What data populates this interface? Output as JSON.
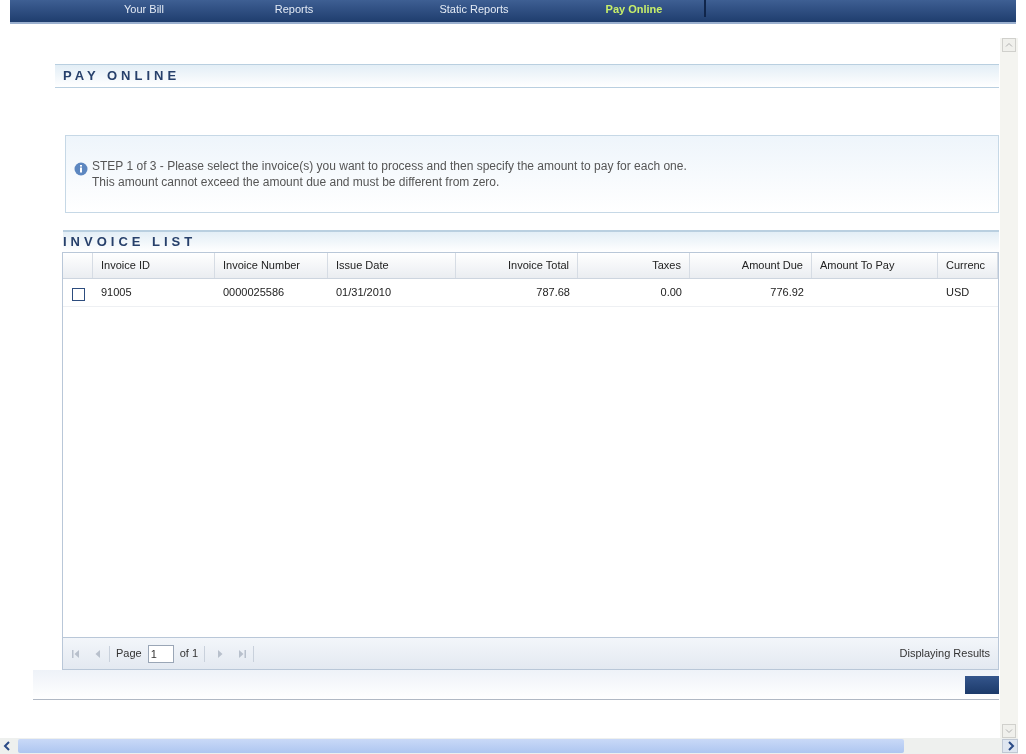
{
  "nav": {
    "tabs": [
      {
        "label": "Your Bill",
        "selected": false
      },
      {
        "label": "Reports",
        "selected": false
      },
      {
        "label": "Static Reports",
        "selected": false
      },
      {
        "label": "Pay Online",
        "selected": true
      }
    ]
  },
  "page_title": "PAY ONLINE",
  "info": {
    "lines": [
      "STEP 1 of 3 - Please select the invoice(s) you want to process and then specify the amount to pay for each one.",
      "This amount cannot exceed the amount due and must be different from zero."
    ]
  },
  "section_title": "INVOICE LIST",
  "table": {
    "columns": [
      "Invoice ID",
      "Invoice Number",
      "Issue Date",
      "Invoice Total",
      "Taxes",
      "Amount Due",
      "Amount To Pay",
      "Currenc"
    ],
    "rows": [
      {
        "checked": false,
        "cells": [
          "91005",
          "0000025586",
          "01/31/2010",
          "787.68",
          "0.00",
          "776.92",
          "",
          "USD"
        ]
      }
    ]
  },
  "pager": {
    "page_label": "Page",
    "page_value": "1",
    "of_label": "of 1",
    "results": "Displaying Results"
  }
}
